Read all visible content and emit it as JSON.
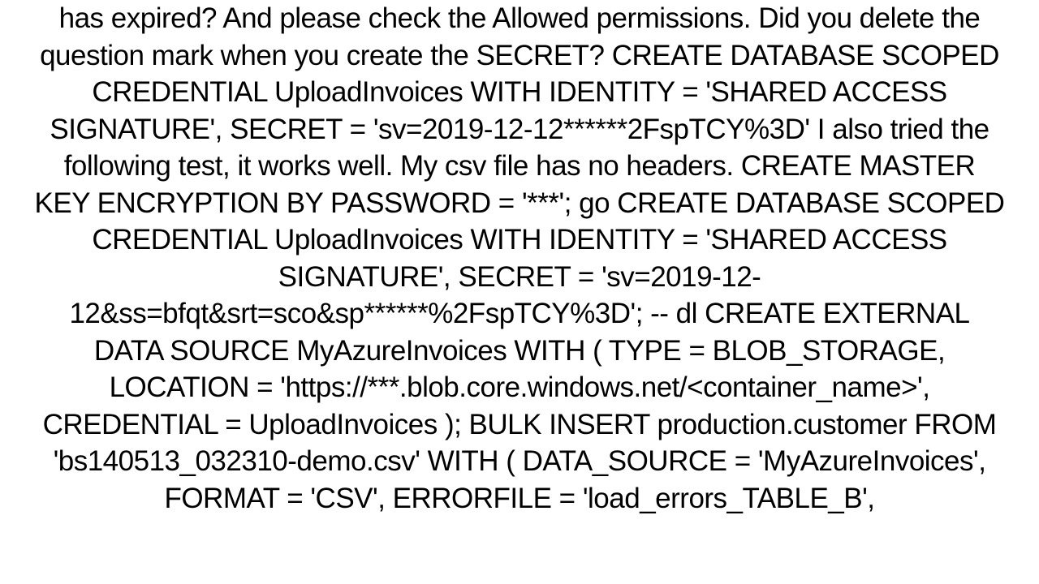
{
  "document": {
    "body_text": "has expired? And please check the Allowed permissions.   Did you delete the question mark when you create the SECRET? CREATE DATABASE SCOPED CREDENTIAL UploadInvoices WITH IDENTITY = 'SHARED ACCESS SIGNATURE', SECRET = 'sv=2019-12-12******2FspTCY%3D'  I also tried the following test, it works well.  My csv file has no headers. CREATE MASTER KEY ENCRYPTION BY PASSWORD = '***'; go  CREATE DATABASE SCOPED CREDENTIAL UploadInvoices WITH IDENTITY = 'SHARED ACCESS SIGNATURE', SECRET = 'sv=2019-12-12&ss=bfqt&srt=sco&sp******%2FspTCY%3D'; -- dl  CREATE EXTERNAL DATA SOURCE MyAzureInvoices     WITH (         TYPE = BLOB_STORAGE,         LOCATION = 'https://***.blob.core.windows.net/<container_name>',         CREDENTIAL = UploadInvoices     );  BULK INSERT production.customer FROM 'bs140513_032310-demo.csv' WITH (         DATA_SOURCE = 'MyAzureInvoices',         FORMAT = 'CSV',         ERRORFILE = 'load_errors_TABLE_B',"
  }
}
